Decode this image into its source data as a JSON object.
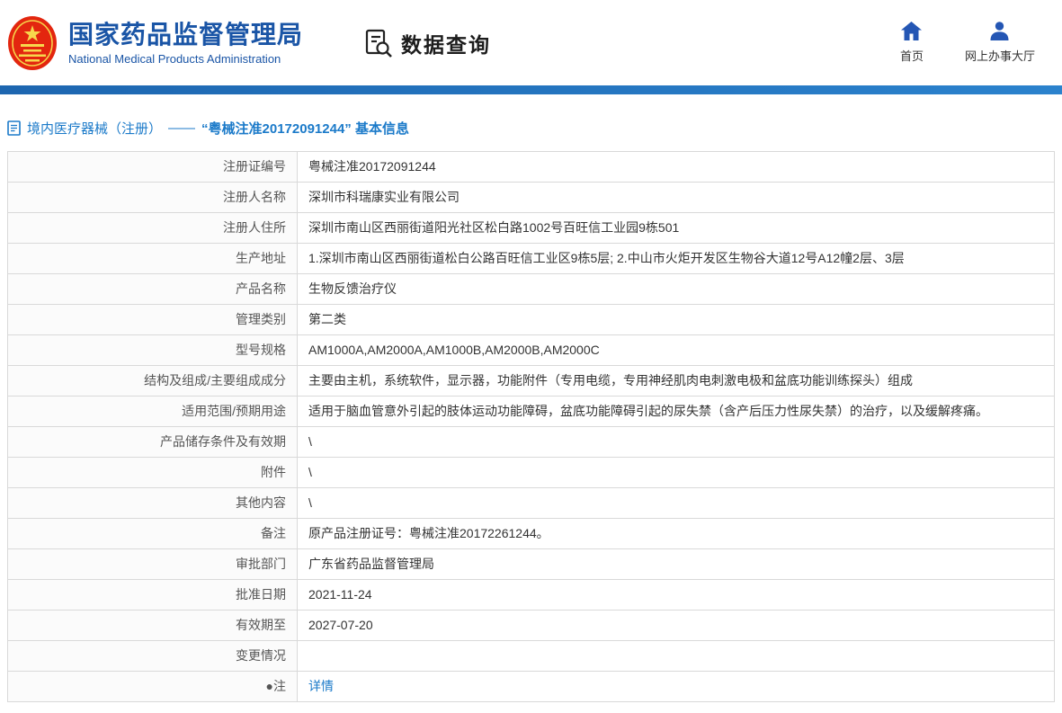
{
  "header": {
    "org_name_cn": "国家药品监督管理局",
    "org_name_en": "National Medical Products Administration",
    "section_title": "数据查询",
    "nav_home": "首页",
    "nav_service_hall": "网上办事大厅"
  },
  "breadcrumb": {
    "section": "境内医疗器械（注册）",
    "dash": "——",
    "detail": "“粤械注准20172091244” 基本信息"
  },
  "colors": {
    "brand_blue": "#1a55a6",
    "bar_blue": "#2478c8",
    "link_blue": "#1b7ac9",
    "emblem_red": "#e3260f",
    "icon_blue": "#2456b4"
  },
  "icons": {
    "emblem": "national-emblem",
    "query": "document-search-icon",
    "home": "home-icon",
    "service": "person-icon",
    "breadcrumb": "document-icon"
  },
  "table": {
    "rows": [
      {
        "label": "注册证编号",
        "value": "粤械注准20172091244"
      },
      {
        "label": "注册人名称",
        "value": "深圳市科瑞康实业有限公司"
      },
      {
        "label": "注册人住所",
        "value": "深圳市南山区西丽街道阳光社区松白路1002号百旺信工业园9栋501"
      },
      {
        "label": "生产地址",
        "value": "1.深圳市南山区西丽街道松白公路百旺信工业区9栋5层; 2.中山市火炬开发区生物谷大道12号A12幢2层、3层"
      },
      {
        "label": "产品名称",
        "value": "生物反馈治疗仪"
      },
      {
        "label": "管理类别",
        "value": "第二类"
      },
      {
        "label": "型号规格",
        "value": "AM1000A,AM2000A,AM1000B,AM2000B,AM2000C"
      },
      {
        "label": "结构及组成/主要组成成分",
        "value": "主要由主机，系统软件，显示器，功能附件（专用电缆，专用神经肌肉电刺激电极和盆底功能训练探头）组成"
      },
      {
        "label": "适用范围/预期用途",
        "value": "适用于脑血管意外引起的肢体运动功能障碍，盆底功能障碍引起的尿失禁（含产后压力性尿失禁）的治疗，以及缓解疼痛。"
      },
      {
        "label": "产品储存条件及有效期",
        "value": "\\"
      },
      {
        "label": "附件",
        "value": "\\"
      },
      {
        "label": "其他内容",
        "value": "\\"
      },
      {
        "label": "备注",
        "value": "原产品注册证号：粤械注准20172261244。"
      },
      {
        "label": "审批部门",
        "value": "广东省药品监督管理局"
      },
      {
        "label": "批准日期",
        "value": "2021-11-24"
      },
      {
        "label": "有效期至",
        "value": "2027-07-20"
      },
      {
        "label": "变更情况",
        "value": ""
      },
      {
        "label": "●注",
        "value": "详情",
        "type": "link"
      }
    ]
  }
}
